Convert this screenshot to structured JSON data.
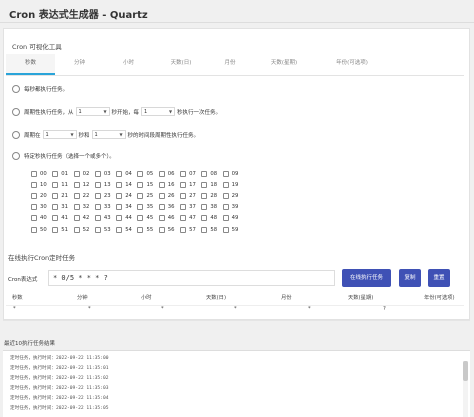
{
  "page_title": "Cron 表达式生成器 - Quartz",
  "card_title": "Cron 可视化工具",
  "tabs": [
    "秒数",
    "分钟",
    "小时",
    "天数(日)",
    "月份",
    "天数(星期)",
    "年份(可选项)"
  ],
  "options": {
    "every_second": "每秒都执行任务。",
    "cycle_prefix": "周期性执行任务，从",
    "cycle_start": "1",
    "cycle_mid": "秒开始，每",
    "cycle_step": "1",
    "cycle_suffix": "秒执行一次任务。",
    "range_prefix": "周期在",
    "range_from": "1",
    "range_mid": "秒和",
    "range_to": "1",
    "range_suffix": "秒的时间段周期性执行任务。",
    "specific": "特定秒执行任务（选择一个或多个）。"
  },
  "seconds": [
    "00",
    "01",
    "02",
    "03",
    "04",
    "05",
    "06",
    "07",
    "08",
    "09",
    "10",
    "11",
    "12",
    "13",
    "14",
    "15",
    "16",
    "17",
    "18",
    "19",
    "20",
    "21",
    "22",
    "23",
    "24",
    "25",
    "26",
    "27",
    "28",
    "29",
    "30",
    "31",
    "32",
    "33",
    "34",
    "35",
    "36",
    "37",
    "38",
    "39",
    "40",
    "41",
    "42",
    "43",
    "44",
    "45",
    "46",
    "47",
    "48",
    "49",
    "50",
    "51",
    "52",
    "53",
    "54",
    "55",
    "56",
    "57",
    "58",
    "59"
  ],
  "run_section_title": "在线执行Cron定时任务",
  "expr_label": "Cron表达式",
  "expr_value": "* 0/5 * * * ?",
  "buttons": {
    "run": "在线执行任务",
    "copy": "复制",
    "reset": "重置"
  },
  "table": {
    "headers": [
      "秒数",
      "分钟",
      "小时",
      "天数(日)",
      "月份",
      "天数(星期)",
      "年份(可选项)"
    ],
    "values": [
      "*",
      "*",
      "*",
      "*",
      "*",
      "?",
      ""
    ]
  },
  "result_title": "最近10执行任务结果",
  "results": [
    "定时任务，执行时间：2022-09-22 11:35:00",
    "定时任务，执行时间：2022-09-22 11:35:01",
    "定时任务，执行时间：2022-09-22 11:35:02",
    "定时任务，执行时间：2022-09-22 11:35:03",
    "定时任务，执行时间：2022-09-22 11:35:04",
    "定时任务，执行时间：2022-09-22 11:35:05"
  ],
  "colors": {
    "primary_button": "#3f51b5",
    "active_tab_underline": "#2aa4d9"
  }
}
